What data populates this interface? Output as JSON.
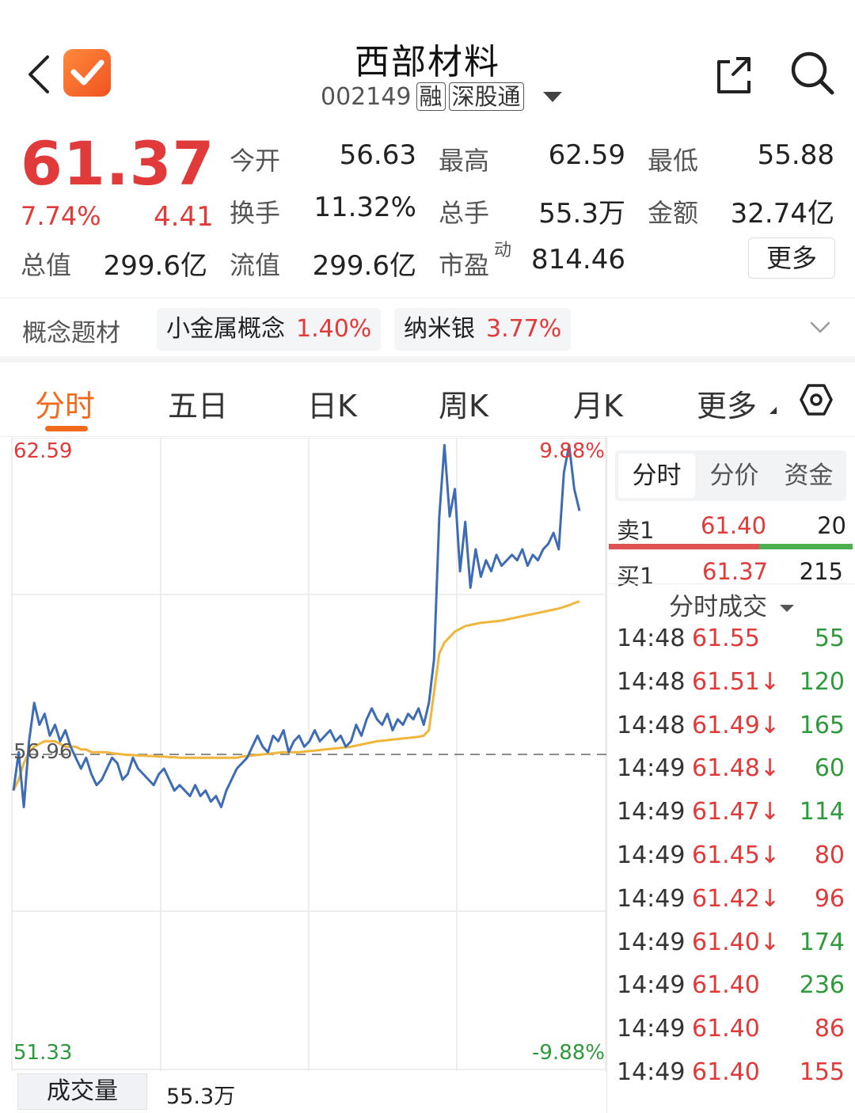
{
  "header": {
    "title": "西部材料",
    "code": "002149",
    "tags": [
      "融",
      "深股通"
    ]
  },
  "quote": {
    "price": "61.37",
    "change_pct": "7.74%",
    "change": "4.41",
    "fields": {
      "open_label": "今开",
      "open": "56.63",
      "high_label": "最高",
      "high": "62.59",
      "low_label": "最低",
      "low": "55.88",
      "turnover_label": "换手",
      "turnover": "11.32%",
      "volume_label": "总手",
      "volume": "55.3万",
      "amount_label": "金额",
      "amount": "32.74亿",
      "mktcap_label": "总值",
      "mktcap": "299.6亿",
      "float_label": "流值",
      "float": "299.6亿",
      "pe_label": "市盈",
      "pe_sup": "动",
      "pe": "814.46"
    },
    "more_label": "更多"
  },
  "concepts": {
    "label": "概念题材",
    "items": [
      {
        "name": "小金属概念",
        "pct": "1.40%"
      },
      {
        "name": "纳米银",
        "pct": "3.77%"
      }
    ]
  },
  "tabs": [
    "分时",
    "五日",
    "日K",
    "周K",
    "月K",
    "更多"
  ],
  "active_tab": 0,
  "chart": {
    "high_price": "62.59",
    "pre_close": "56.96",
    "low_price": "51.33",
    "high_pct": "9.88%",
    "low_pct": "-9.88%"
  },
  "chart_data": {
    "type": "line",
    "ylim": [
      51.33,
      62.59
    ],
    "reference": 56.96,
    "series": [
      {
        "values": [
          56.3,
          57.0,
          56.0,
          57.2,
          57.9,
          57.5,
          57.7,
          57.3,
          57.5,
          57.2,
          57.4,
          57.1,
          56.9,
          56.7,
          56.9,
          56.6,
          56.4,
          56.5,
          56.7,
          56.9,
          56.8,
          56.5,
          56.6,
          56.9,
          56.7,
          56.6,
          56.5,
          56.4,
          56.6,
          56.7,
          56.5,
          56.3,
          56.4,
          56.3,
          56.2,
          56.4,
          56.2,
          56.3,
          56.1,
          56.2,
          56.0,
          56.3,
          56.5,
          56.7,
          56.8,
          56.9,
          57.1,
          57.3,
          57.1,
          57.0,
          57.3,
          57.2,
          57.4,
          57.0,
          57.2,
          57.3,
          57.1,
          57.2,
          57.4,
          57.2,
          57.3,
          57.4,
          57.2,
          57.3,
          57.1,
          57.2,
          57.5,
          57.3,
          57.6,
          57.8,
          57.6,
          57.5,
          57.7,
          57.4,
          57.6,
          57.5,
          57.7,
          57.6,
          57.8,
          57.5,
          57.9,
          58.7,
          61.3,
          62.6,
          61.3,
          61.8,
          60.3,
          61.2,
          60.0,
          60.7,
          60.2,
          60.5,
          60.3,
          60.6,
          60.4,
          60.5,
          60.6,
          60.5,
          60.7,
          60.4,
          60.6,
          60.5,
          60.7,
          60.8,
          61.0,
          60.7,
          62.1,
          62.6,
          61.8,
          61.4
        ],
        "color": "#3e6cb4"
      },
      {
        "values": [
          56.3,
          56.5,
          56.8,
          57.0,
          57.1,
          57.15,
          57.2,
          57.2,
          57.2,
          57.15,
          57.1,
          57.1,
          57.1,
          57.05,
          57.05,
          57.0,
          57.0,
          57.0,
          57.0,
          56.98,
          56.97,
          56.96,
          56.95,
          56.95,
          56.94,
          56.94,
          56.93,
          56.93,
          56.92,
          56.92,
          56.91,
          56.91,
          56.9,
          56.9,
          56.9,
          56.9,
          56.9,
          56.9,
          56.9,
          56.9,
          56.9,
          56.9,
          56.9,
          56.9,
          56.92,
          56.93,
          56.94,
          56.95,
          56.96,
          56.97,
          56.98,
          56.99,
          57.0,
          57.0,
          57.0,
          57.0,
          57.01,
          57.02,
          57.03,
          57.04,
          57.05,
          57.06,
          57.07,
          57.08,
          57.09,
          57.1,
          57.12,
          57.14,
          57.16,
          57.18,
          57.2,
          57.21,
          57.22,
          57.23,
          57.24,
          57.25,
          57.26,
          57.27,
          57.28,
          57.3,
          57.4,
          58.1,
          58.8,
          59.0,
          59.1,
          59.2,
          59.25,
          59.3,
          59.32,
          59.34,
          59.36,
          59.37,
          59.38,
          59.39,
          59.4,
          59.42,
          59.44,
          59.46,
          59.48,
          59.5,
          59.52,
          59.54,
          59.56,
          59.58,
          59.6,
          59.62,
          59.65,
          59.68,
          59.72,
          59.75
        ],
        "color": "#f0b53c"
      }
    ]
  },
  "volume": {
    "label": "成交量",
    "value": "55.3万"
  },
  "panel": {
    "tabs": [
      "分时",
      "分价",
      "资金"
    ],
    "active_tab": 0,
    "ask": {
      "label": "卖1",
      "price": "61.40",
      "qty": "20"
    },
    "bid": {
      "label": "买1",
      "price": "61.37",
      "qty": "215"
    },
    "trades_title": "分时成交",
    "trades": [
      {
        "time": "14:48",
        "price": "61.55",
        "arrow": "",
        "qty": "55",
        "qty_color": "green"
      },
      {
        "time": "14:48",
        "price": "61.51",
        "arrow": "↓",
        "qty": "120",
        "qty_color": "green"
      },
      {
        "time": "14:48",
        "price": "61.49",
        "arrow": "↓",
        "qty": "165",
        "qty_color": "green"
      },
      {
        "time": "14:49",
        "price": "61.48",
        "arrow": "↓",
        "qty": "60",
        "qty_color": "green"
      },
      {
        "time": "14:49",
        "price": "61.47",
        "arrow": "↓",
        "qty": "114",
        "qty_color": "green"
      },
      {
        "time": "14:49",
        "price": "61.45",
        "arrow": "↓",
        "qty": "80",
        "qty_color": "red"
      },
      {
        "time": "14:49",
        "price": "61.42",
        "arrow": "↓",
        "qty": "96",
        "qty_color": "red"
      },
      {
        "time": "14:49",
        "price": "61.40",
        "arrow": "↓",
        "qty": "174",
        "qty_color": "green"
      },
      {
        "time": "14:49",
        "price": "61.40",
        "arrow": "",
        "qty": "236",
        "qty_color": "green"
      },
      {
        "time": "14:49",
        "price": "61.40",
        "arrow": "",
        "qty": "86",
        "qty_color": "red"
      },
      {
        "time": "14:49",
        "price": "61.40",
        "arrow": "",
        "qty": "155",
        "qty_color": "red"
      }
    ]
  },
  "colors": {
    "up": "#e03a3a",
    "down": "#2e9a3c",
    "accent": "#f26b1d",
    "price_line": "#3e6cb4",
    "avg_line": "#f0b53c"
  }
}
